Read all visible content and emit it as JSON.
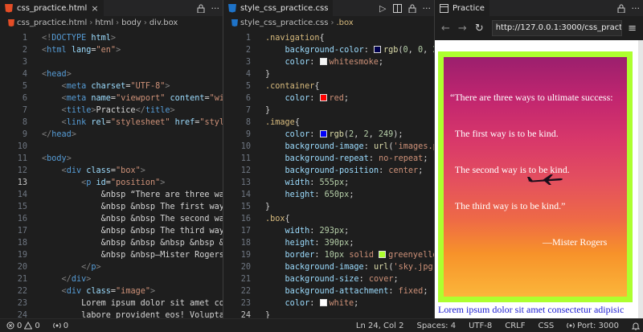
{
  "pane1": {
    "tab": "css_practice.html",
    "close": "×",
    "crumbs": [
      "css_practice.html",
      "html",
      "body",
      "div.box"
    ],
    "lines": [
      {
        "n": "1",
        "html": "<span class='t-br'>&lt;!</span><span class='t-tag'>DOCTYPE</span> <span class='t-at'>html</span><span class='t-br'>&gt;</span>"
      },
      {
        "n": "2",
        "html": "<span class='t-br'>&lt;</span><span class='t-tag'>html</span> <span class='t-at'>lang</span>=<span class='t-st'>\"en\"</span><span class='t-br'>&gt;</span>"
      },
      {
        "n": "3",
        "html": ""
      },
      {
        "n": "4",
        "html": "<span class='t-br'>&lt;</span><span class='t-tag'>head</span><span class='t-br'>&gt;</span>"
      },
      {
        "n": "5",
        "html": "    <span class='t-br'>&lt;</span><span class='t-tag'>meta</span> <span class='t-at'>charset</span>=<span class='t-st'>\"UTF-8\"</span><span class='t-br'>&gt;</span>"
      },
      {
        "n": "6",
        "html": "    <span class='t-br'>&lt;</span><span class='t-tag'>meta</span> <span class='t-at'>name</span>=<span class='t-st'>\"viewport\"</span> <span class='t-at'>content</span>=<span class='t-st'>\"wi</span>"
      },
      {
        "n": "7",
        "html": "    <span class='t-br'>&lt;</span><span class='t-tag'>title</span><span class='t-br'>&gt;</span>Practice<span class='t-br'>&lt;/</span><span class='t-tag'>title</span><span class='t-br'>&gt;</span>"
      },
      {
        "n": "8",
        "html": "    <span class='t-br'>&lt;</span><span class='t-tag'>link</span> <span class='t-at'>rel</span>=<span class='t-st'>\"stylesheet\"</span> <span class='t-at'>href</span>=<span class='t-st'>\"styl</span>"
      },
      {
        "n": "9",
        "html": "<span class='t-br'>&lt;/</span><span class='t-tag'>head</span><span class='t-br'>&gt;</span>"
      },
      {
        "n": "10",
        "html": ""
      },
      {
        "n": "11",
        "html": "<span class='t-br'>&lt;</span><span class='t-tag'>body</span><span class='t-br'>&gt;</span>"
      },
      {
        "n": "12",
        "html": "    <span class='t-br'>&lt;</span><span class='t-tag'>div</span> <span class='t-at'>class</span>=<span class='t-st'>\"box\"</span><span class='t-br'>&gt;</span>"
      },
      {
        "n": "13",
        "html": "        <span class='t-br'>&lt;</span><span class='t-tag'>p</span> <span class='t-at'>id</span>=<span class='t-st'>\"position\"</span><span class='t-br'>&gt;</span>"
      },
      {
        "n": "14",
        "html": "            &amp;nbsp “There are three wa"
      },
      {
        "n": "15",
        "html": "            &amp;nbsp &amp;nbsp The first way"
      },
      {
        "n": "16",
        "html": "            &amp;nbsp &amp;nbsp The second wa"
      },
      {
        "n": "17",
        "html": "            &amp;nbsp &amp;nbsp The third way"
      },
      {
        "n": "18",
        "html": "            &amp;nbsp &amp;nbsp &amp;nbsp &amp;nbsp &amp;"
      },
      {
        "n": "19",
        "html": "            &amp;nbsp &amp;nbsp—Mister Rogers"
      },
      {
        "n": "20",
        "html": "        <span class='t-br'>&lt;/</span><span class='t-tag'>p</span><span class='t-br'>&gt;</span>"
      },
      {
        "n": "21",
        "html": "    <span class='t-br'>&lt;/</span><span class='t-tag'>div</span><span class='t-br'>&gt;</span>"
      },
      {
        "n": "22",
        "html": "    <span class='t-br'>&lt;</span><span class='t-tag'>div</span> <span class='t-at'>class</span>=<span class='t-st'>\"image\"</span><span class='t-br'>&gt;</span>"
      },
      {
        "n": "23",
        "html": "        Lorem ipsum dolor sit amet co"
      },
      {
        "n": "24",
        "html": "        labore provident eos! Volupta"
      }
    ]
  },
  "pane2": {
    "tab": "style_css_practice.css",
    "crumbs": [
      "style_css_practice.css",
      ".box"
    ],
    "lines": [
      {
        "n": "1",
        "html": "<span class='t-sel'>.navigation</span><span class='t-pun'>{</span>"
      },
      {
        "n": "2",
        "html": "    <span class='t-prop'>background-color</span>: <span class='sw' style='background:#00004e'></span><span class='t-fn'>rgb</span>(<span class='t-num'>0</span>, <span class='t-num'>0</span>, <span class='t-num'>2</span>"
      },
      {
        "n": "3",
        "html": "    <span class='t-prop'>color</span>: <span class='sw' style='background:#f5f5f5'></span><span class='t-val'>whitesmoke</span>;"
      },
      {
        "n": "4",
        "html": "<span class='t-pun'>}</span>"
      },
      {
        "n": "5",
        "html": "<span class='t-sel'>.container</span><span class='t-pun'>{</span>"
      },
      {
        "n": "6",
        "html": "    <span class='t-prop'>color</span>: <span class='sw' style='background:#ff0000'></span><span class='t-val'>red</span>;"
      },
      {
        "n": "7",
        "html": "<span class='t-pun'>}</span>"
      },
      {
        "n": "8",
        "html": "<span class='t-sel'>.image</span><span class='t-pun'>{</span>"
      },
      {
        "n": "9",
        "html": "    <span class='t-prop'>color</span>: <span class='sw' style='background:#0202f9'></span><span class='t-fn'>rgb</span>(<span class='t-num'>2</span>, <span class='t-num'>2</span>, <span class='t-num'>249</span>);"
      },
      {
        "n": "10",
        "html": "    <span class='t-prop'>background-image</span>: <span class='t-fn'>url</span>(<span class='t-st'>'images.p</span>"
      },
      {
        "n": "11",
        "html": "    <span class='t-prop'>background-repeat</span>: <span class='t-val'>no-repeat</span>;"
      },
      {
        "n": "12",
        "html": "    <span class='t-prop'>background-position</span>: <span class='t-val'>center</span>;"
      },
      {
        "n": "13",
        "html": "    <span class='t-prop'>width</span>: <span class='t-num'>555px</span>;"
      },
      {
        "n": "14",
        "html": "    <span class='t-prop'>height</span>: <span class='t-num'>650px</span>;"
      },
      {
        "n": "15",
        "html": "<span class='t-pun'>}</span>"
      },
      {
        "n": "16",
        "html": "<span class='t-sel'>.box</span><span class='t-pun'>{</span>"
      },
      {
        "n": "17",
        "html": "    <span class='t-prop'>width</span>: <span class='t-num'>293px</span>;"
      },
      {
        "n": "18",
        "html": "    <span class='t-prop'>height</span>: <span class='t-num'>390px</span>;"
      },
      {
        "n": "19",
        "html": "    <span class='t-prop'>border</span>: <span class='t-num'>10px</span> <span class='t-val'>solid</span> <span class='sw' style='background:#adff2f'></span><span class='t-val'>greenyello</span>"
      },
      {
        "n": "20",
        "html": "    <span class='t-prop'>background-image</span>: <span class='t-fn'>url</span>(<span class='t-st'>'sky.jpg'</span>"
      },
      {
        "n": "21",
        "html": "    <span class='t-prop'>background-size</span>: <span class='t-val'>cover</span>;"
      },
      {
        "n": "22",
        "html": "    <span class='t-prop'>background-attachment</span>: <span class='t-val'>fixed</span>;"
      },
      {
        "n": "23",
        "html": "    <span class='t-prop'>color</span>: <span class='sw' style='background:#ffffff'></span><span class='t-val'>white</span>;"
      },
      {
        "n": "24",
        "html": "<span class='t-pun'>}</span>"
      }
    ]
  },
  "preview": {
    "tab": "Practice",
    "url": "http://127.0.0.1:3000/css_practic",
    "back": "←",
    "forward": "→",
    "reload": "↻",
    "menu": "≡",
    "quote_lines": [
      "“There are three ways to ultimate success:",
      "  The first way is to be kind.",
      "  The second way is to be kind.",
      "  The third way is to be kind.”"
    ],
    "author": "—Mister Rogers",
    "lorem": "Lorem ipsum dolor sit amet consectetur adipisic"
  },
  "status": {
    "errors": "0",
    "warnings": "0",
    "ports": "0",
    "position": "Ln 24, Col 2",
    "spaces": "Spaces: 4",
    "encoding": "UTF-8",
    "eol": "CRLF",
    "language": "CSS",
    "port": "Port: 3000"
  },
  "colors": {
    "editor_bg": "#1e1e1e",
    "box_border": "#adff2f",
    "lorem_text": "#1a1ad2"
  }
}
